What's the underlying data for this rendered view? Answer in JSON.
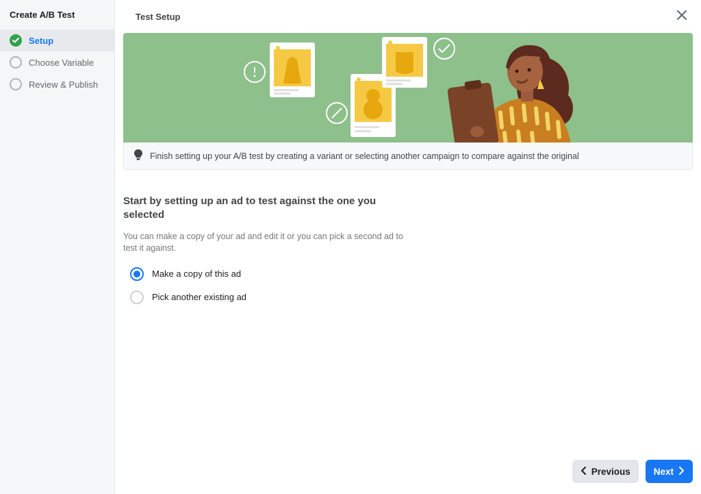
{
  "sidebar": {
    "title": "Create A/B Test",
    "steps": [
      {
        "label": "Setup",
        "state": "active_done"
      },
      {
        "label": "Choose Variable",
        "state": "pending"
      },
      {
        "label": "Review & Publish",
        "state": "pending"
      }
    ]
  },
  "header": {
    "title": "Test Setup"
  },
  "info": {
    "message": "Finish setting up your A/B test by creating a variant or selecting another campaign to compare against the original"
  },
  "body": {
    "heading": "Start by setting up an ad to test against the one you selected",
    "description": "You can make a copy of your ad and edit it or you can pick a second ad to test it against.",
    "options": [
      {
        "label": "Make a copy of this ad",
        "selected": true
      },
      {
        "label": "Pick another existing ad",
        "selected": false
      }
    ]
  },
  "footer": {
    "previous": "Previous",
    "next": "Next"
  }
}
